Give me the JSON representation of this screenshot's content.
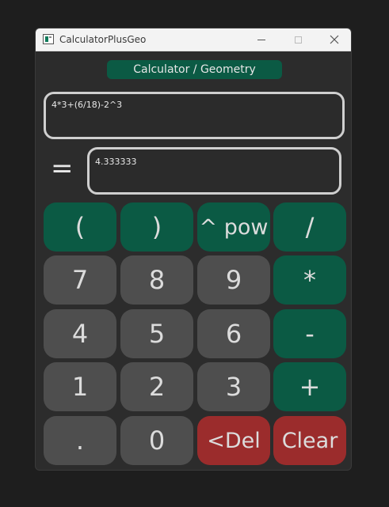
{
  "window": {
    "title": "CalculatorPlusGeo"
  },
  "mode_label": "Calculator / Geometry",
  "expression": "4*3+(6/18)-2^3",
  "equals_sign": "=",
  "result": "4.333333",
  "buttons": {
    "open_paren": "(",
    "close_paren": ")",
    "pow": "^ pow",
    "divide": "/",
    "seven": "7",
    "eight": "8",
    "nine": "9",
    "multiply": "*",
    "four": "4",
    "five": "5",
    "six": "6",
    "minus": "-",
    "one": "1",
    "two": "2",
    "three": "3",
    "plus": "+",
    "dot": ".",
    "zero": "0",
    "del": "<Del",
    "clear": "Clear"
  },
  "colors": {
    "accent_green": "#0b5a44",
    "number_gray": "#4e4e4e",
    "danger_red": "#9b2c2c"
  }
}
